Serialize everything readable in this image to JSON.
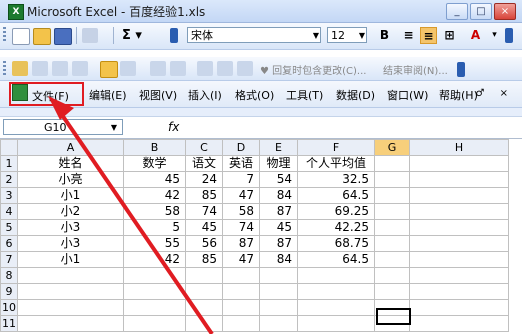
{
  "window": {
    "title": "Microsoft Excel - 百度经验1.xls",
    "app_icon": "X"
  },
  "toolbar": {
    "font_name": "宋体",
    "font_size": "12",
    "bold": "B",
    "tb2_text1": "♥ 回复时包含更改(C)...",
    "tb2_text2": "结束审阅(N)..."
  },
  "menu": {
    "items": [
      "文件(F)",
      "编辑(E)",
      "视图(V)",
      "插入(I)",
      "格式(O)",
      "工具(T)",
      "数据(D)",
      "窗口(W)",
      "帮助(H)"
    ]
  },
  "formula": {
    "name_box": "G10",
    "fx": "fx"
  },
  "sheet": {
    "columns": [
      "A",
      "B",
      "C",
      "D",
      "E",
      "F",
      "G",
      "H"
    ],
    "rows": [
      [
        "姓名",
        "数学",
        "语文",
        "英语",
        "物理",
        "个人平均值",
        "",
        ""
      ],
      [
        "小亮",
        "45",
        "24",
        "7",
        "54",
        "32.5",
        "",
        ""
      ],
      [
        "小1",
        "42",
        "85",
        "47",
        "84",
        "64.5",
        "",
        ""
      ],
      [
        "小2",
        "58",
        "74",
        "58",
        "87",
        "69.25",
        "",
        ""
      ],
      [
        "小3",
        "5",
        "45",
        "74",
        "45",
        "42.25",
        "",
        ""
      ],
      [
        "小3",
        "55",
        "56",
        "87",
        "87",
        "68.75",
        "",
        ""
      ],
      [
        "小1",
        "42",
        "85",
        "47",
        "84",
        "64.5",
        "",
        ""
      ],
      [
        "",
        "",
        "",
        "",
        "",
        "",
        "",
        ""
      ],
      [
        "",
        "",
        "",
        "",
        "",
        "",
        "",
        ""
      ],
      [
        "",
        "",
        "",
        "",
        "",
        "",
        "",
        ""
      ],
      [
        "",
        "",
        "",
        "",
        "",
        "",
        "",
        ""
      ]
    ],
    "row_numbers": [
      "1",
      "2",
      "3",
      "4",
      "5",
      "6",
      "7",
      "8",
      "9",
      "10",
      "11"
    ]
  },
  "colors": {
    "highlight": "#e01c22",
    "selected_col": "#f7cf7b"
  }
}
